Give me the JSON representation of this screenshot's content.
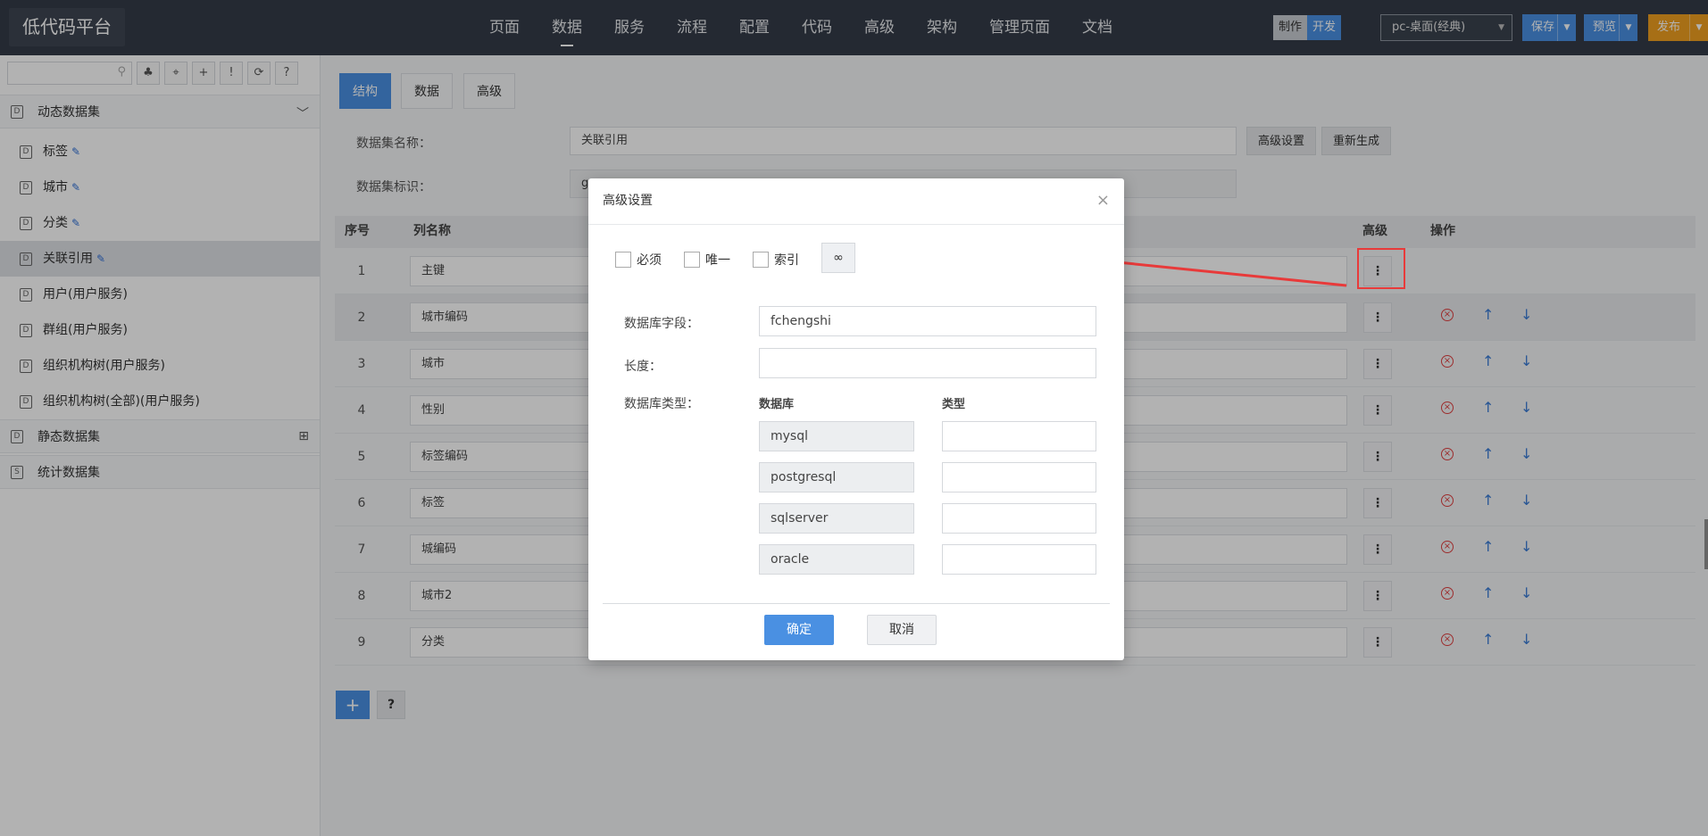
{
  "app": {
    "title": "低代码平台"
  },
  "nav": [
    "页面",
    "数据",
    "服务",
    "流程",
    "配置",
    "代码",
    "高级",
    "架构",
    "管理页面",
    "文档"
  ],
  "header": {
    "mode_make": "制作",
    "mode_dev": "开发",
    "device": "pc-桌面(经典)",
    "save": "保存",
    "preview": "预览",
    "publish": "发布"
  },
  "sidebar": {
    "groups": [
      {
        "label": "动态数据集"
      },
      {
        "label": "静态数据集"
      },
      {
        "label": "统计数据集"
      }
    ],
    "items": [
      {
        "label": "标签"
      },
      {
        "label": "城市"
      },
      {
        "label": "分类"
      },
      {
        "label": "关联引用"
      },
      {
        "label": "用户(用户服务)"
      },
      {
        "label": "群组(用户服务)"
      },
      {
        "label": "组织机构树(用户服务)"
      },
      {
        "label": "组织机构树(全部)(用户服务)"
      }
    ]
  },
  "content": {
    "tabs": [
      "结构",
      "数据",
      "高级"
    ],
    "dataset_name_label": "数据集名称：",
    "dataset_name_value": "关联引用",
    "dataset_id_label": "数据集标识：",
    "dataset_id_value": "g",
    "advanced_settings_btn": "高级设置",
    "regenerate_btn": "重新生成",
    "columns": {
      "index": "序号",
      "name": "列名称",
      "advanced": "高级",
      "actions": "操作"
    },
    "rows": [
      {
        "index": "1",
        "name": "主键"
      },
      {
        "index": "2",
        "name": "城市编码"
      },
      {
        "index": "3",
        "name": "城市"
      },
      {
        "index": "4",
        "name": "性别"
      },
      {
        "index": "5",
        "name": "标签编码"
      },
      {
        "index": "6",
        "name": "标签"
      },
      {
        "index": "7",
        "name": "城编码"
      },
      {
        "index": "8",
        "name": "城市2"
      },
      {
        "index": "9",
        "name": "分类"
      }
    ],
    "add_btn": "+",
    "help_btn": "?"
  },
  "modal": {
    "title": "高级设置",
    "close": "×",
    "checkbox_required": "必须",
    "checkbox_unique": "唯一",
    "checkbox_index": "索引",
    "link_icon": "∞",
    "db_field_label": "数据库字段：",
    "db_field_value": "fchengshi",
    "length_label": "长度：",
    "length_value": "",
    "db_type_label": "数据库类型：",
    "db_col_header": "数据库",
    "type_col_header": "类型",
    "databases": [
      "mysql",
      "postgresql",
      "sqlserver",
      "oracle"
    ],
    "ok": "确定",
    "cancel": "取消"
  },
  "colors": {
    "topbar": "#343c48",
    "accent": "#4a90e2",
    "publish": "#f0a020",
    "highlight": "#e83a3a",
    "delete": "#e04040"
  }
}
